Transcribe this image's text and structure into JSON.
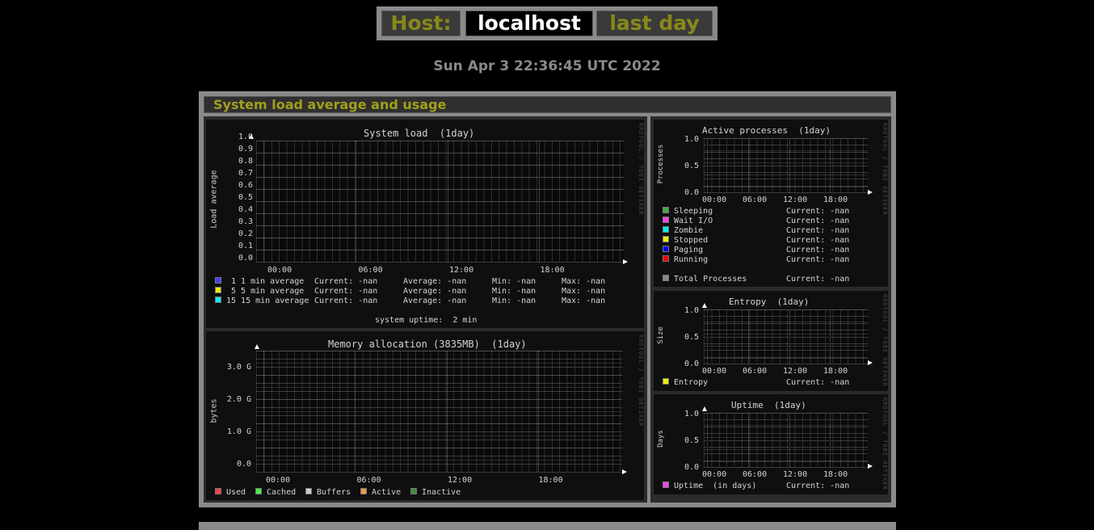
{
  "header": {
    "host_label": "Host:",
    "host_name": "localhost",
    "period": "last day"
  },
  "datetime": "Sun Apr 3 22:36:45 UTC 2022",
  "section": {
    "title": "System load average and usage"
  },
  "watermark": "RRDTOOL / TOBI OETIKER",
  "system_load": {
    "title": "System load  (1day)",
    "ylabel": "Load average",
    "yticks": [
      "1.0",
      "0.9",
      "0.8",
      "0.7",
      "0.6",
      "0.5",
      "0.4",
      "0.3",
      "0.2",
      "0.1",
      "0.0"
    ],
    "xticks": [
      "00:00",
      "06:00",
      "12:00",
      "18:00"
    ],
    "legend": [
      {
        "name": "1 min average",
        "num": " 1",
        "current": "Current: -nan",
        "average": "Average: -nan",
        "min": "Min: -nan",
        "max": "Max: -nan",
        "color": "#4040ff"
      },
      {
        "name": "5 min average",
        "num": " 5",
        "current": "Current: -nan",
        "average": "Average: -nan",
        "min": "Min: -nan",
        "max": "Max: -nan",
        "color": "#eeee00"
      },
      {
        "name": "15 min average",
        "num": "15",
        "current": "Current: -nan",
        "average": "Average: -nan",
        "min": "Min: -nan",
        "max": "Max: -nan",
        "color": "#00eeee"
      }
    ],
    "footer": "system uptime:  2 min"
  },
  "memory": {
    "title": "Memory allocation (3835MB)  (1day)",
    "ylabel": "bytes",
    "yticks": [
      "3.0 G",
      "2.0 G",
      "1.0 G",
      "0.0"
    ],
    "xticks": [
      "00:00",
      "06:00",
      "12:00",
      "18:00"
    ],
    "legend": [
      {
        "name": "Used",
        "color": "#ee4444"
      },
      {
        "name": "Cached",
        "color": "#44ee44"
      },
      {
        "name": "Buffers",
        "color": "#cccccc"
      },
      {
        "name": "Active",
        "color": "#ee9944"
      },
      {
        "name": "Inactive",
        "color": "#448844"
      }
    ]
  },
  "processes": {
    "title": "Active processes  (1day)",
    "ylabel": "Processes",
    "yticks": [
      "1.0",
      "0.5",
      "0.0"
    ],
    "xticks": [
      "00:00",
      "06:00",
      "12:00",
      "18:00"
    ],
    "legend": [
      {
        "name": "Sleeping",
        "current": "Current: -nan",
        "color": "#44aa44"
      },
      {
        "name": "Wait I/O",
        "current": "Current: -nan",
        "color": "#ee44ee"
      },
      {
        "name": "Zombie",
        "current": "Current: -nan",
        "color": "#00eeee"
      },
      {
        "name": "Stopped",
        "current": "Current: -nan",
        "color": "#eeee00"
      },
      {
        "name": "Paging",
        "current": "Current: -nan",
        "color": "#0000ee"
      },
      {
        "name": "Running",
        "current": "Current: -nan",
        "color": "#ee0000"
      }
    ],
    "total": {
      "name": "Total Processes",
      "current": "Current: -nan",
      "color": "#888888"
    }
  },
  "entropy": {
    "title": "Entropy  (1day)",
    "ylabel": "Size",
    "yticks": [
      "1.0",
      "0.5",
      "0.0"
    ],
    "xticks": [
      "00:00",
      "06:00",
      "12:00",
      "18:00"
    ],
    "legend": [
      {
        "name": "Entropy",
        "current": "Current: -nan",
        "color": "#eeee00"
      }
    ]
  },
  "uptime": {
    "title": "Uptime  (1day)",
    "ylabel": "Days",
    "yticks": [
      "1.0",
      "0.5",
      "0.0"
    ],
    "xticks": [
      "00:00",
      "06:00",
      "12:00",
      "18:00"
    ],
    "legend": [
      {
        "name": "Uptime  (in days)",
        "current": "Current: -nan",
        "color": "#ee44ee"
      }
    ]
  }
}
